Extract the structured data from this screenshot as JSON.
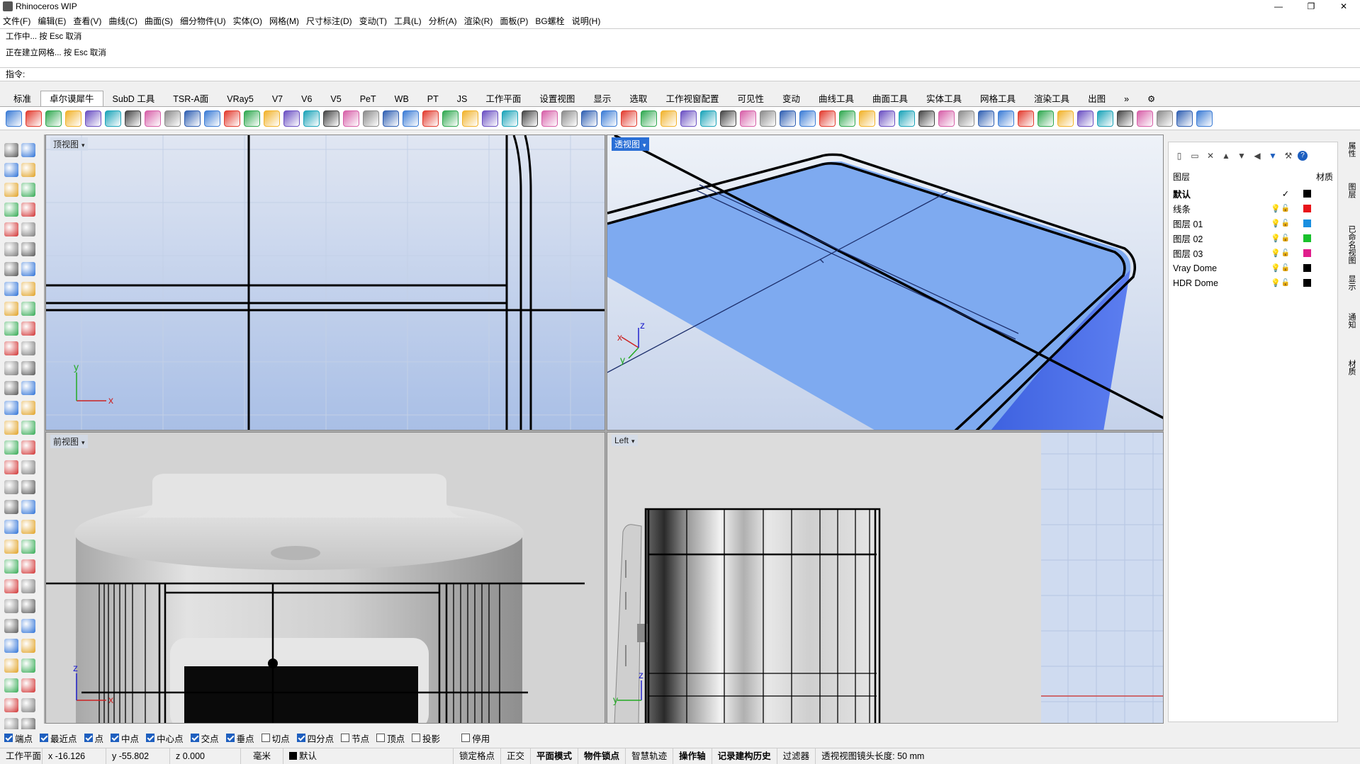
{
  "window": {
    "title": "Rhinoceros WIP",
    "controls": [
      "—",
      "❐",
      "✕"
    ]
  },
  "menu": [
    "文件(F)",
    "编辑(E)",
    "查看(V)",
    "曲线(C)",
    "曲面(S)",
    "细分物件(U)",
    "实体(O)",
    "网格(M)",
    "尺寸标注(D)",
    "变动(T)",
    "工具(L)",
    "分析(A)",
    "渲染(R)",
    "面板(P)",
    "BG螺栓",
    "说明(H)"
  ],
  "command_history": [
    "工作中... 按 Esc 取消",
    "正在建立网格... 按 Esc 取消"
  ],
  "command_prompt": "指令:",
  "tabs": [
    "标准",
    "卓尔谟犀牛",
    "SubD 工具",
    "TSR-A面",
    "VRay5",
    "V7",
    "V6",
    "V5",
    "PeT",
    "WB",
    "PT",
    "JS",
    "工作平面",
    "设置视图",
    "显示",
    "选取",
    "工作视窗配置",
    "可见性",
    "变动",
    "曲线工具",
    "曲面工具",
    "实体工具",
    "网格工具",
    "渲染工具",
    "出图"
  ],
  "active_tab_index": 1,
  "viewports": {
    "top": {
      "label": "顶视图",
      "axis_x": "x",
      "axis_y": "y"
    },
    "perspective": {
      "label": "透视图",
      "axis_x": "x",
      "axis_y": "y",
      "axis_z": "z"
    },
    "front": {
      "label": "前视图",
      "axis_x": "x",
      "axis_z": "z"
    },
    "left": {
      "label": "Left",
      "axis_y": "y",
      "axis_z": "z"
    }
  },
  "layers_panel": {
    "header_left": "图层",
    "header_right": "材质",
    "layers": [
      {
        "name": "默认",
        "current": true,
        "color": "#000000",
        "bold": true
      },
      {
        "name": "线条",
        "current": false,
        "color": "#e8141a",
        "bold": false
      },
      {
        "name": "图层 01",
        "current": false,
        "color": "#1a8fe0",
        "bold": false
      },
      {
        "name": "图层 02",
        "current": false,
        "color": "#19c12c",
        "bold": false
      },
      {
        "name": "图层 03",
        "current": false,
        "color": "#e01e8c",
        "bold": false
      },
      {
        "name": "Vray Dome",
        "current": false,
        "color": "#000000",
        "bold": false
      },
      {
        "name": "HDR Dome",
        "current": false,
        "color": "#000000",
        "bold": false
      }
    ]
  },
  "side_tabs": [
    "属性",
    "图层",
    "已命名视图",
    "显示",
    "通知",
    "材质"
  ],
  "osnaps": [
    {
      "label": "端点",
      "on": true
    },
    {
      "label": "最近点",
      "on": true
    },
    {
      "label": "点",
      "on": true
    },
    {
      "label": "中点",
      "on": true
    },
    {
      "label": "中心点",
      "on": true
    },
    {
      "label": "交点",
      "on": true
    },
    {
      "label": "垂点",
      "on": true
    },
    {
      "label": "切点",
      "on": false
    },
    {
      "label": "四分点",
      "on": true
    },
    {
      "label": "节点",
      "on": false
    },
    {
      "label": "顶点",
      "on": false
    },
    {
      "label": "投影",
      "on": false
    },
    {
      "label": "停用",
      "on": false
    }
  ],
  "status": {
    "cplane": "工作平面",
    "x": "x -16.126",
    "y": "y -55.802",
    "z": "z 0.000",
    "units": "毫米",
    "layer": "默认",
    "toggles": [
      "锁定格点",
      "正交",
      "平面模式",
      "物件锁点",
      "智慧轨迹",
      "操作轴",
      "记录建构历史",
      "过滤器"
    ],
    "toggles_bold": [
      false,
      false,
      true,
      true,
      false,
      true,
      true,
      false
    ],
    "message": "透视视图镜头长度: 50 mm"
  },
  "colors": {
    "accent": "#2a6fd6",
    "viewport_top": "#dfe6f2",
    "viewport_bottom": "#93aee0",
    "surface_blue": "#7eaaf0"
  }
}
